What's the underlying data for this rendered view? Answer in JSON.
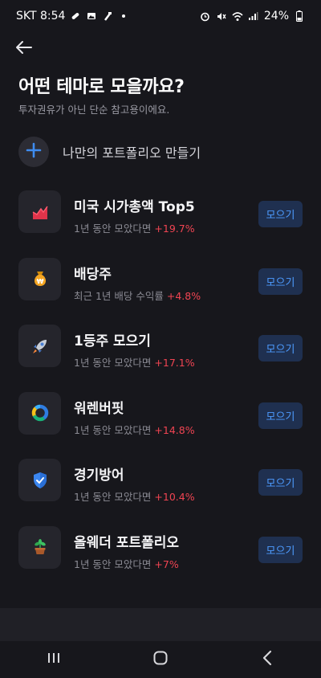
{
  "status": {
    "carrier_time": "SKT 8:54",
    "battery": "24%"
  },
  "page": {
    "title": "어떤 테마로 모을까요?",
    "subtitle": "투자권유가 아닌 단순 참고용이에요."
  },
  "create": {
    "label": "나만의 포트폴리오 만들기"
  },
  "themes": [
    {
      "name": "미국 시가총액 Top5",
      "desc": "1년 동안 모았다면",
      "rate": "+19.7%",
      "button": "모으기",
      "icon": "trending-chart-icon"
    },
    {
      "name": "배당주",
      "desc": "최근 1년 배당 수익률",
      "rate": "+4.8%",
      "button": "모으기",
      "icon": "money-bag-icon"
    },
    {
      "name": "1등주 모으기",
      "desc": "1년 동안 모았다면",
      "rate": "+17.1%",
      "button": "모으기",
      "icon": "rocket-icon"
    },
    {
      "name": "워렌버핏",
      "desc": "1년 동안 모았다면",
      "rate": "+14.8%",
      "button": "모으기",
      "icon": "donut-chart-icon"
    },
    {
      "name": "경기방어",
      "desc": "1년 동안 모았다면",
      "rate": "+10.4%",
      "button": "모으기",
      "icon": "shield-check-icon"
    },
    {
      "name": "올웨더 포트폴리오",
      "desc": "1년 동안 모았다면",
      "rate": "+7%",
      "button": "모으기",
      "icon": "potted-plant-icon"
    }
  ],
  "colors": {
    "background": "#17171c",
    "accent": "#4d9bff",
    "positive": "#f04452"
  }
}
